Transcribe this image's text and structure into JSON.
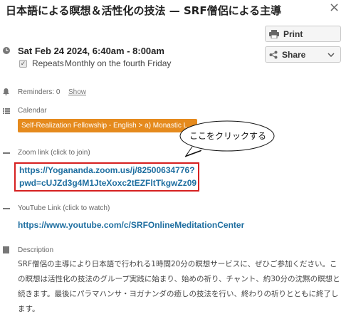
{
  "event": {
    "title": "日本語による瞑想＆活性化の技法 — SRF僧侶による主導",
    "date_time": "Sat Feb 24 2024, 6:40am - 8:00am",
    "repeats_label": "Repeats",
    "repeats_value": "Monthly on the fourth Friday"
  },
  "actions": {
    "close_label": "×",
    "print_label": "Print",
    "share_label": "Share"
  },
  "reminders": {
    "label": "Reminders: 0",
    "show_label": "Show"
  },
  "calendar": {
    "label": "Calendar",
    "value": "Self-Realization Fellowship - English > a) Monastic L",
    "color": "#e58a1d"
  },
  "annotation": {
    "callout_text": "ここをクリックする",
    "highlight_color": "#d62020"
  },
  "zoom": {
    "label": "Zoom link (click to join)",
    "link_line1": "https://Yogananda.zoom.us/j/82500634776?",
    "link_line2": "pwd=cUJZd3g4M1JteXoxc2tEZFltTkgwZz09"
  },
  "youtube": {
    "label": "YouTube Link (click to watch)",
    "link": "https://www.youtube.com/c/SRFOnlineMeditationCenter"
  },
  "description": {
    "label": "Description",
    "text": "SRF僧侶の主導により日本語で行われる1時間20分の瞑想サービスに、ぜひご参加ください。この瞑想は活性化の技法のグループ実践に始まり、始めの祈り、チャント、約30分の沈黙の瞑想と続きます。最後にパラマハンサ・ヨガナンダの癒しの技法を行い、終わりの祈りとともに終了します。"
  },
  "colors": {
    "link": "#1e6ea0",
    "icon": "#777777"
  }
}
